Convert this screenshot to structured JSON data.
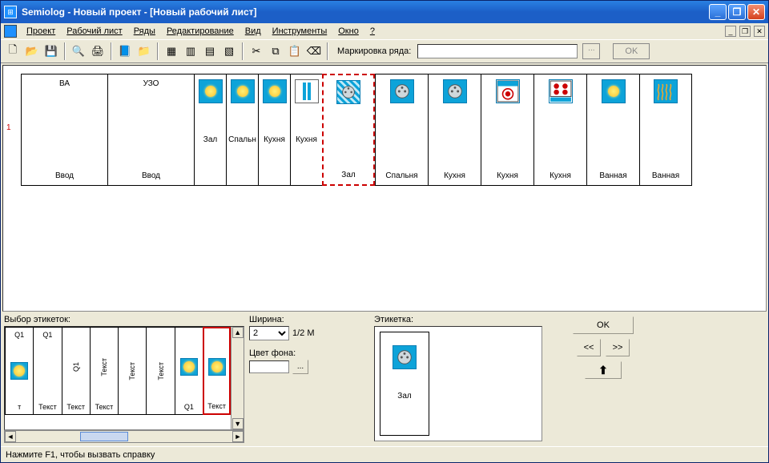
{
  "window": {
    "title": "Semiolog - Новый проект - [Новый рабочий лист]"
  },
  "menu": {
    "items": [
      "Проект",
      "Рабочий лист",
      "Ряды",
      "Редактирование",
      "Вид",
      "Инструменты",
      "Окно",
      "?"
    ]
  },
  "toolbar": {
    "marker_label": "Маркировка ряда:",
    "marker_value": "",
    "ok": "OK"
  },
  "workspace": {
    "row_number": "1",
    "slots": [
      {
        "type": "wide",
        "top": "ВА",
        "bottom": "Ввод",
        "icon": null
      },
      {
        "type": "wide",
        "top": "УЗО",
        "bottom": "Ввод",
        "icon": null
      },
      {
        "type": "narrow",
        "top": "",
        "bottom": "Зал",
        "icon": "light"
      },
      {
        "type": "narrow",
        "top": "",
        "bottom": "Спальн",
        "icon": "light"
      },
      {
        "type": "narrow",
        "top": "",
        "bottom": "Кухня",
        "icon": "light"
      },
      {
        "type": "narrow",
        "top": "",
        "bottom": "Кухня",
        "icon": "fluor"
      },
      {
        "type": "std",
        "top": "",
        "bottom": "Зал",
        "icon": "socket-hatched",
        "selected": true
      },
      {
        "type": "std",
        "top": "",
        "bottom": "Спальня",
        "icon": "socket"
      },
      {
        "type": "std",
        "top": "",
        "bottom": "Кухня",
        "icon": "socket"
      },
      {
        "type": "std",
        "top": "",
        "bottom": "Кухня",
        "icon": "washer"
      },
      {
        "type": "std",
        "top": "",
        "bottom": "Кухня",
        "icon": "cooktop"
      },
      {
        "type": "std",
        "top": "",
        "bottom": "Ванная",
        "icon": "light"
      },
      {
        "type": "std",
        "top": "",
        "bottom": "Ванная",
        "icon": "heater"
      }
    ]
  },
  "picker": {
    "title": "Выбор этикеток:",
    "items": [
      {
        "top": "Q1",
        "bottom": "т",
        "icon": "light",
        "v": false
      },
      {
        "top": "Q1",
        "bottom": "Текст",
        "icon": null,
        "v": false
      },
      {
        "top": "",
        "bottom": "Текст",
        "icon": null,
        "v": true,
        "vlabel": "Q1"
      },
      {
        "top": "",
        "bottom": "Текст",
        "icon": null,
        "v": true,
        "vlabel": "Текст"
      },
      {
        "top": "",
        "bottom": "",
        "icon": null,
        "v": true,
        "vlabel": "Текст"
      },
      {
        "top": "",
        "bottom": "",
        "icon": null,
        "v": true,
        "vlabel": "Текст"
      },
      {
        "top": "",
        "bottom": "Q1",
        "icon": "light",
        "v": false
      },
      {
        "top": "",
        "bottom": "Текст",
        "icon": "light",
        "v": false,
        "selected": true
      }
    ]
  },
  "props": {
    "width_label": "Ширина:",
    "width_value": "2",
    "width_unit": "1/2 M",
    "bg_label": "Цвет фона:",
    "bg_value": ""
  },
  "preview": {
    "title": "Этикетка:",
    "icon": "socket",
    "label": "Зал"
  },
  "buttons": {
    "ok": "OK",
    "prev": "<<",
    "next": ">>",
    "up": "⬆"
  },
  "statusbar": {
    "text": "Нажмите F1, чтобы вызвать справку"
  }
}
